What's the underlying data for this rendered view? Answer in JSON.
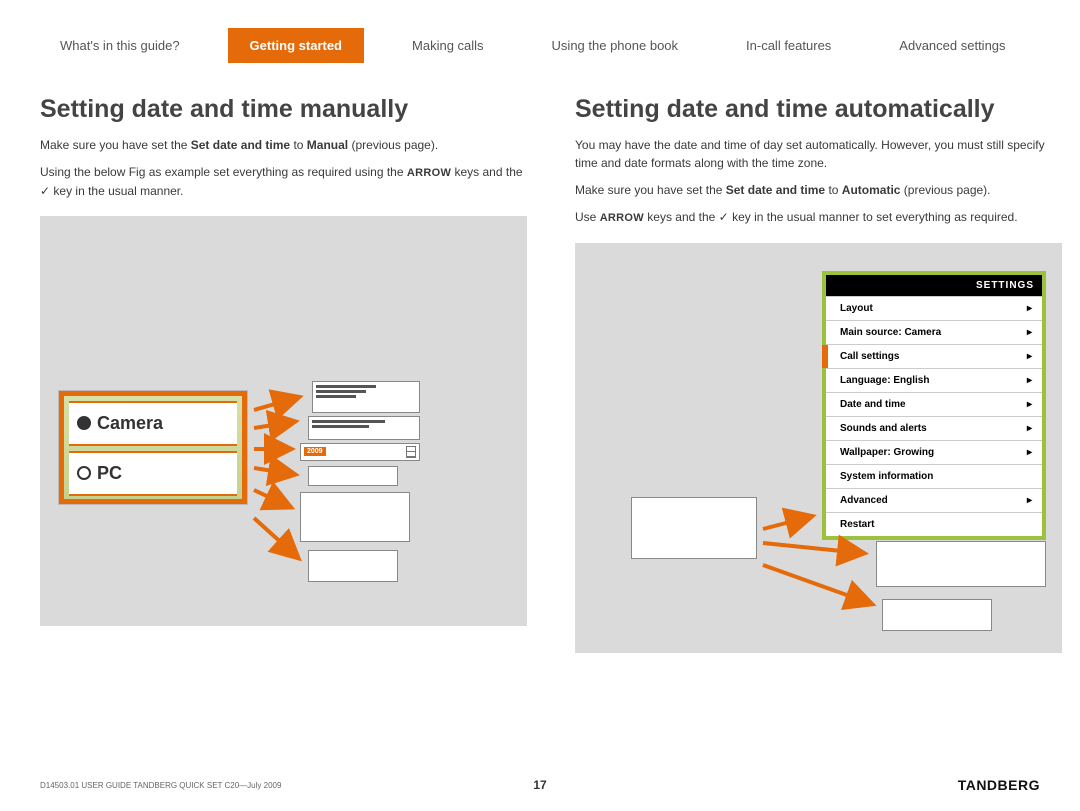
{
  "tabs": {
    "t0": "What's in this guide?",
    "t1": "Getting started",
    "t2": "Making calls",
    "t3": "Using the phone book",
    "t4": "In-call features",
    "t5": "Advanced settings"
  },
  "left": {
    "heading": "Setting date and time manually",
    "p1a": "Make sure you have set the ",
    "p1b": "Set date and time",
    "p1c": " to ",
    "p1d": "Manual",
    "p1e": " (previous page).",
    "p2a": "Using the below Fig as example set everything as required using the ",
    "p2b": "ARROW",
    "p2c": " keys and the ✓ key in the usual manner.",
    "fig": {
      "camera": "Camera",
      "pc": "PC",
      "year": "2009"
    }
  },
  "right": {
    "heading": "Setting date and time automatically",
    "p1": "You may have the date and time of day set automatically. However, you must still specify time and date formats along with the time zone.",
    "p2a": "Make sure you have set the ",
    "p2b": "Set date and time",
    "p2c": " to ",
    "p2d": "Automatic",
    "p2e": " (previous page).",
    "p3a": "Use ",
    "p3b": "ARROW",
    "p3c": " keys and the ✓ key in the usual manner to set everything as required.",
    "settings": {
      "title": "SETTINGS",
      "rows": {
        "r0": "Layout",
        "r1": "Main source: Camera",
        "r2": "Call settings",
        "r3": "Language: English",
        "r4": "Date and time",
        "r5": "Sounds and alerts",
        "r6": "Wallpaper: Growing",
        "r7": "System information",
        "r8": "Advanced",
        "r9": "Restart"
      }
    }
  },
  "footer": {
    "docid": "D14503.01 USER GUIDE TANDBERG QUICK SET C20—July 2009",
    "page": "17",
    "brand": "TANDBERG"
  }
}
